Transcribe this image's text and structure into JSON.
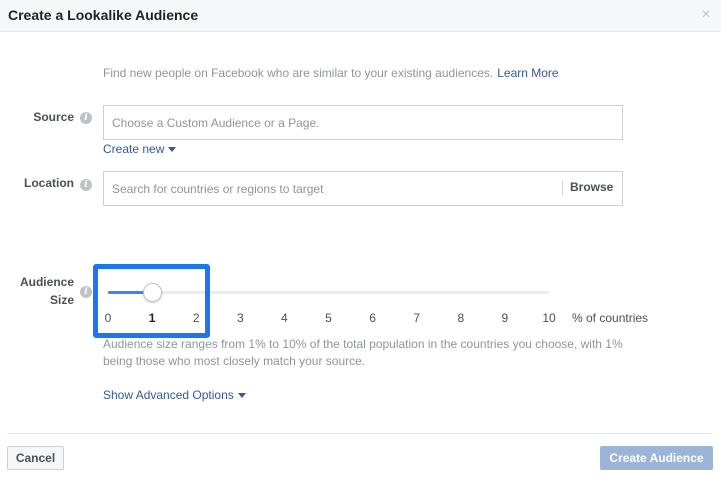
{
  "header": {
    "title": "Create a Lookalike Audience",
    "close_glyph": "×",
    "close_icon": "close-icon"
  },
  "intro": {
    "text": "Find new people on Facebook who are similar to your existing audiences.",
    "link": "Learn More"
  },
  "source": {
    "label": "Source",
    "info_glyph": "i",
    "placeholder": "Choose a Custom Audience or a Page.",
    "create_new": "Create new"
  },
  "location": {
    "label": "Location",
    "info_glyph": "i",
    "placeholder": "Search for countries or regions to target",
    "browse": "Browse"
  },
  "audience_size": {
    "label_line1": "Audience",
    "label_line2": "Size",
    "info_glyph": "i",
    "value": 1,
    "min": 0,
    "max": 10,
    "ticks": [
      "0",
      "1",
      "2",
      "3",
      "4",
      "5",
      "6",
      "7",
      "8",
      "9",
      "10"
    ],
    "unit": "% of countries",
    "help": "Audience size ranges from 1% to 10% of the total population in the countries you choose, with 1% being those who most closely match your source."
  },
  "advanced": {
    "label": "Show Advanced Options"
  },
  "footer": {
    "cancel": "Cancel",
    "create": "Create Audience"
  },
  "colors": {
    "accent": "#4080ff",
    "link": "#365899",
    "highlight": "#1877f2",
    "disabled_button": "#9cb4d8"
  }
}
